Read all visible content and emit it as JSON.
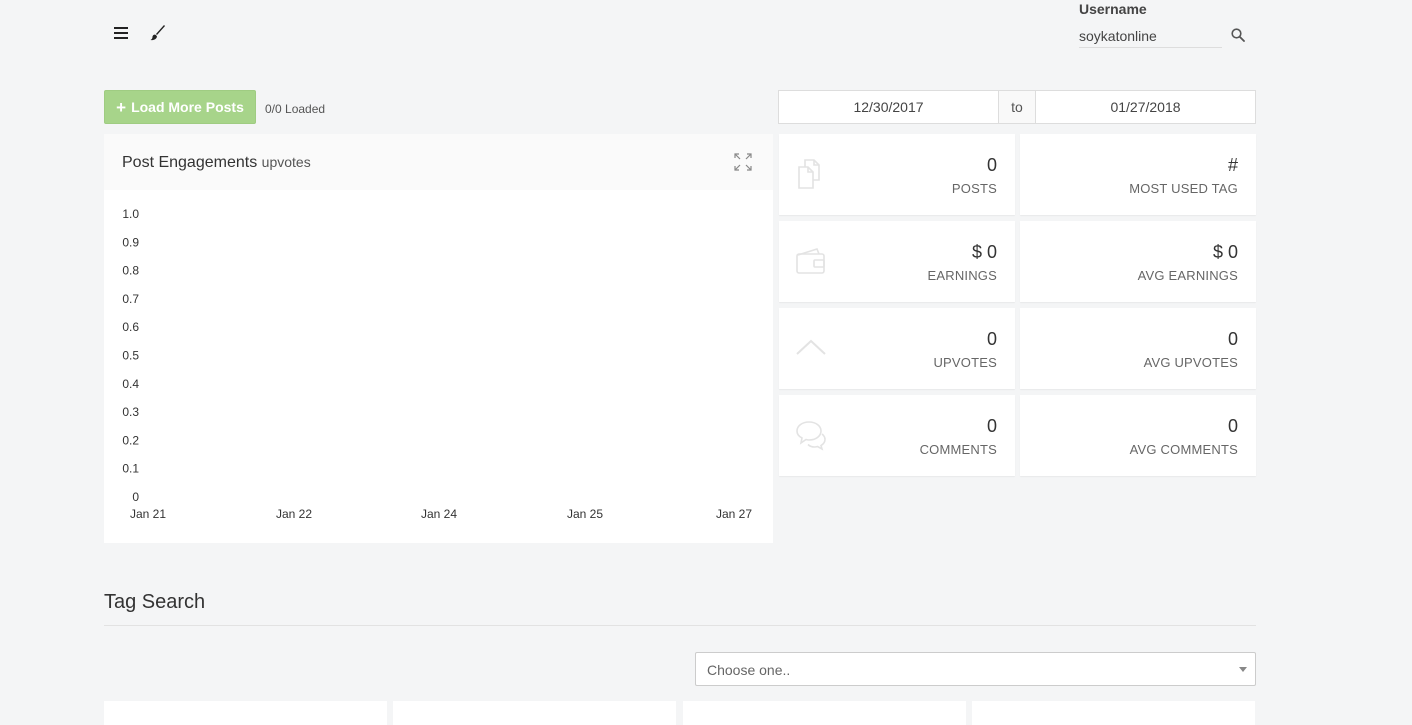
{
  "header": {
    "menu_icon": "hamburger-menu-icon",
    "brush_icon": "paint-brush-icon",
    "username_label": "Username",
    "username_value": "soykatonline",
    "search_icon": "magnifier-search-icon"
  },
  "toolbar": {
    "load_more_label": "Load More Posts",
    "loaded_text": "0/0 Loaded",
    "date_from": "12/30/2017",
    "date_separator": "to",
    "date_to": "01/27/2018"
  },
  "chart_panel": {
    "title": "Post Engagements",
    "subtitle": "upvotes",
    "expand_icon": "expand-arrows-icon"
  },
  "chart_data": {
    "type": "line",
    "title": "Post Engagements",
    "subtitle": "upvotes",
    "x_tick_labels": [
      "Jan 21",
      "Jan 22",
      "Jan 24",
      "Jan 25",
      "Jan 27"
    ],
    "y_tick_labels": [
      "0",
      "0.1",
      "0.2",
      "0.3",
      "0.4",
      "0.5",
      "0.6",
      "0.7",
      "0.8",
      "0.9",
      "1.0"
    ],
    "ylim": [
      0,
      1
    ],
    "series": [],
    "grid": false,
    "legend": "none"
  },
  "stats": [
    {
      "value": "0",
      "label": "POSTS",
      "icon": "documents-icon"
    },
    {
      "value": "#",
      "label": "MOST USED TAG",
      "icon": ""
    },
    {
      "value": "$ 0",
      "label": "EARNINGS",
      "icon": "wallet-icon"
    },
    {
      "value": "$ 0",
      "label": "AVG EARNINGS",
      "icon": ""
    },
    {
      "value": "0",
      "label": "UPVOTES",
      "icon": "chevron-up-icon"
    },
    {
      "value": "0",
      "label": "AVG UPVOTES",
      "icon": ""
    },
    {
      "value": "0",
      "label": "COMMENTS",
      "icon": "comments-icon"
    },
    {
      "value": "0",
      "label": "AVG COMMENTS",
      "icon": ""
    }
  ],
  "tag_search": {
    "title": "Tag Search",
    "select_placeholder": "Choose one.."
  },
  "colors": {
    "accent_green": "#a7d48a",
    "background": "#f4f5f6",
    "panel": "#ffffff",
    "icon_faint": "#e3e3e3"
  }
}
